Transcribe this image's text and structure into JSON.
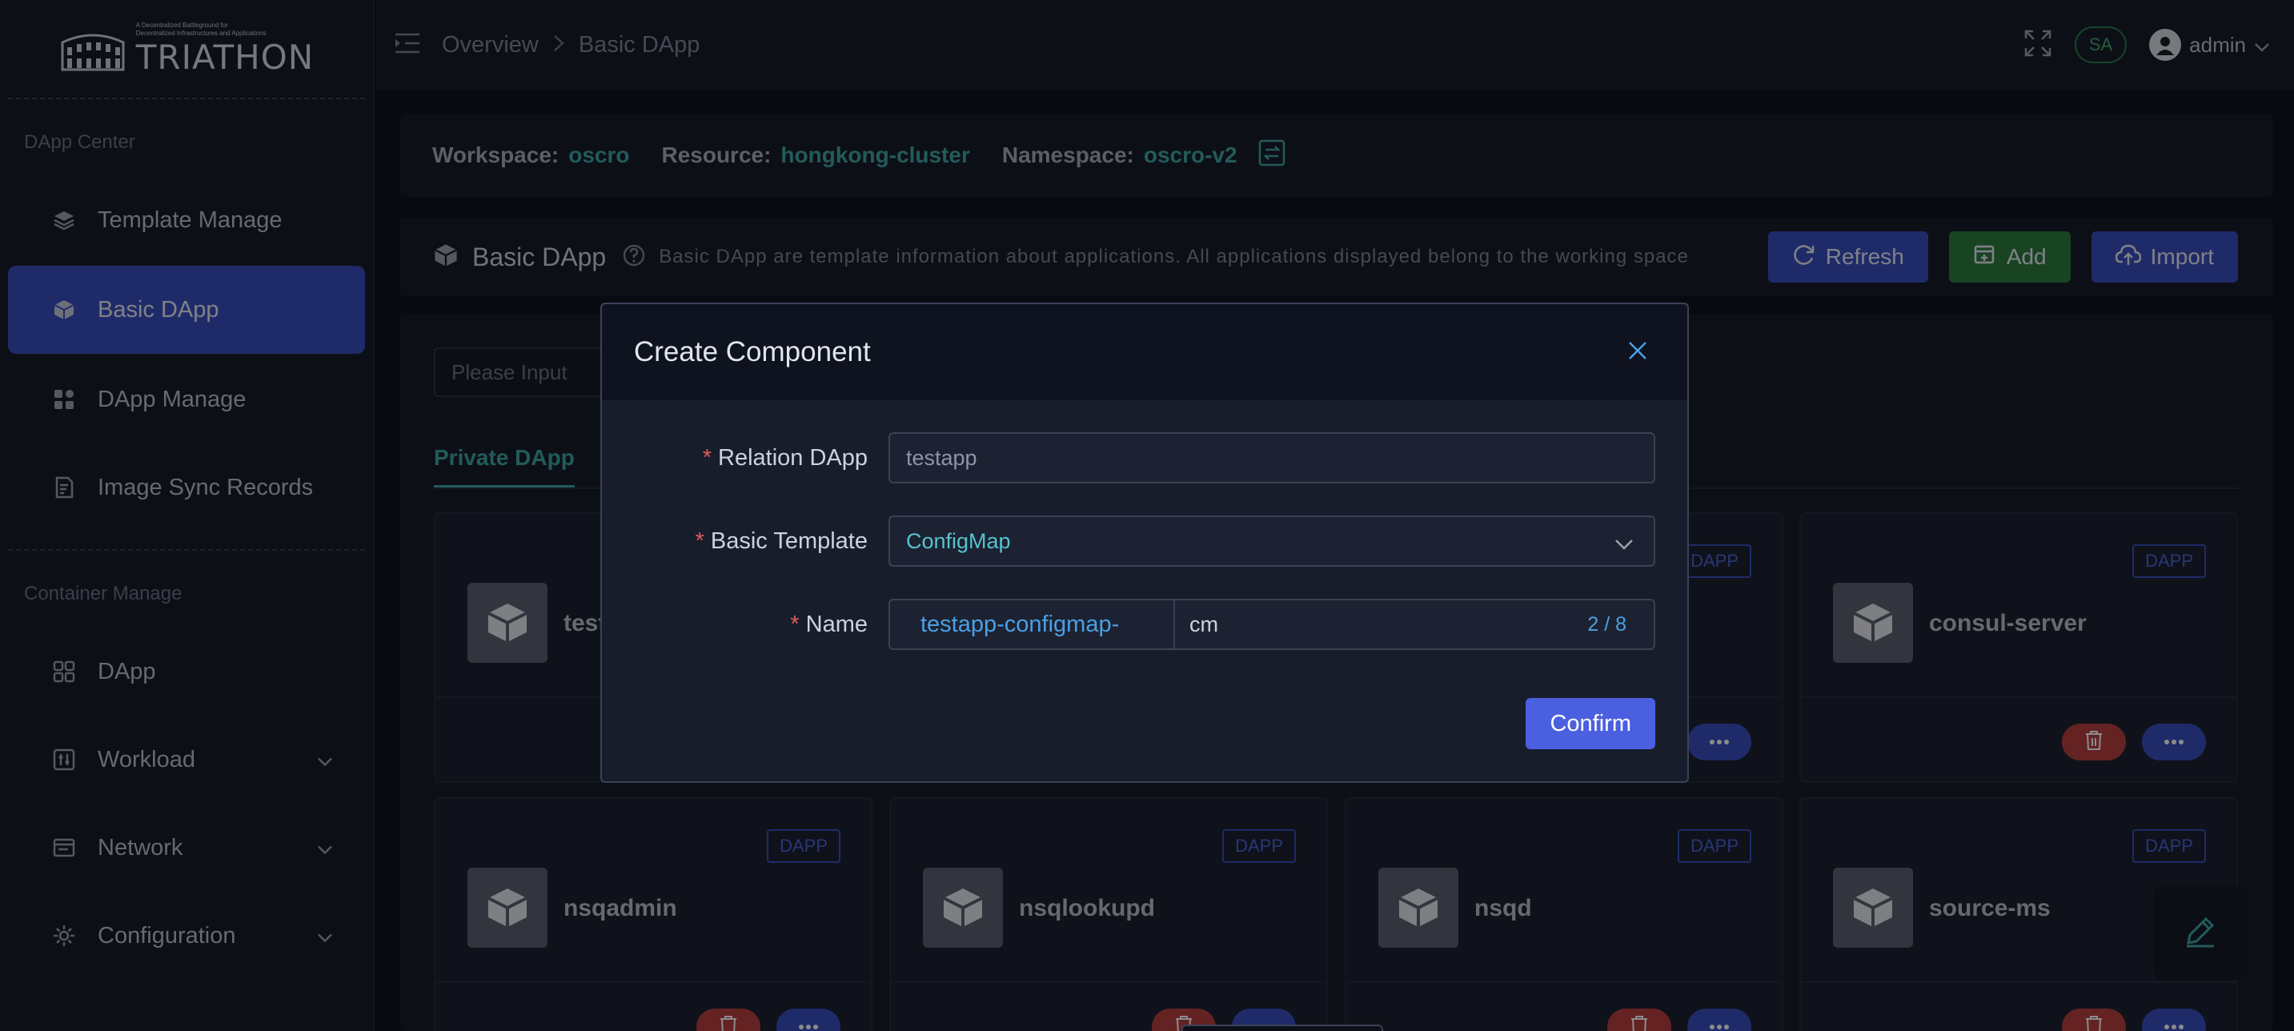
{
  "brand": {
    "tagline_1": "A Decentralized Battleground for",
    "tagline_2": "Decentralized Infrastructures and Applications",
    "name": "TRIATHON"
  },
  "sidebar": {
    "sections": [
      {
        "title": "DApp Center",
        "items": [
          {
            "label": "Template Manage",
            "icon": "layers-icon"
          },
          {
            "label": "Basic DApp",
            "icon": "cube-icon",
            "active": true
          },
          {
            "label": "DApp Manage",
            "icon": "apps-icon"
          },
          {
            "label": "Image Sync Records",
            "icon": "records-icon"
          }
        ]
      },
      {
        "title": "Container Manage",
        "items": [
          {
            "label": "DApp",
            "icon": "grid-icon"
          },
          {
            "label": "Workload",
            "icon": "sliders-icon",
            "expandable": true
          },
          {
            "label": "Network",
            "icon": "network-icon",
            "expandable": true
          },
          {
            "label": "Configuration",
            "icon": "gear-icon",
            "expandable": true
          }
        ]
      }
    ]
  },
  "header": {
    "breadcrumb": [
      "Overview",
      "Basic DApp"
    ],
    "badge": "SA",
    "user": "admin"
  },
  "workspace": {
    "workspace_label": "Workspace:",
    "workspace_value": "oscro",
    "resource_label": "Resource:",
    "resource_value": "hongkong-cluster",
    "namespace_label": "Namespace:",
    "namespace_value": "oscro-v2"
  },
  "page": {
    "title": "Basic DApp",
    "description": "Basic DApp are template information about applications. All applications displayed belong to the working space",
    "buttons": {
      "refresh": "Refresh",
      "add": "Add",
      "import": "Import"
    },
    "search_placeholder": "Please Input",
    "tab": "Private DApp"
  },
  "cards": [
    {
      "name": "test",
      "badge": ""
    },
    {
      "name": "",
      "badge": "DAPP"
    },
    {
      "name": "consul-server",
      "badge": "DAPP"
    },
    {
      "name": "nsqadmin",
      "badge": "DAPP"
    },
    {
      "name": "nsqlookupd",
      "badge": "DAPP"
    },
    {
      "name": "nsqd",
      "badge": "DAPP"
    },
    {
      "name": "source-ms",
      "badge": "DAPP"
    }
  ],
  "modal": {
    "title": "Create Component",
    "relation_label": "Relation DApp",
    "relation_value": "testapp",
    "template_label": "Basic Template",
    "template_value": "ConfigMap",
    "name_label": "Name",
    "name_prefix": "testapp-configmap-",
    "name_value": "cm",
    "name_count": "2 / 8",
    "required_mark": "*",
    "confirm": "Confirm"
  },
  "colors": {
    "accent": "#3a4fbf",
    "teal": "#3fa7a4",
    "danger": "#b6403f",
    "success": "#2f7d3f"
  }
}
